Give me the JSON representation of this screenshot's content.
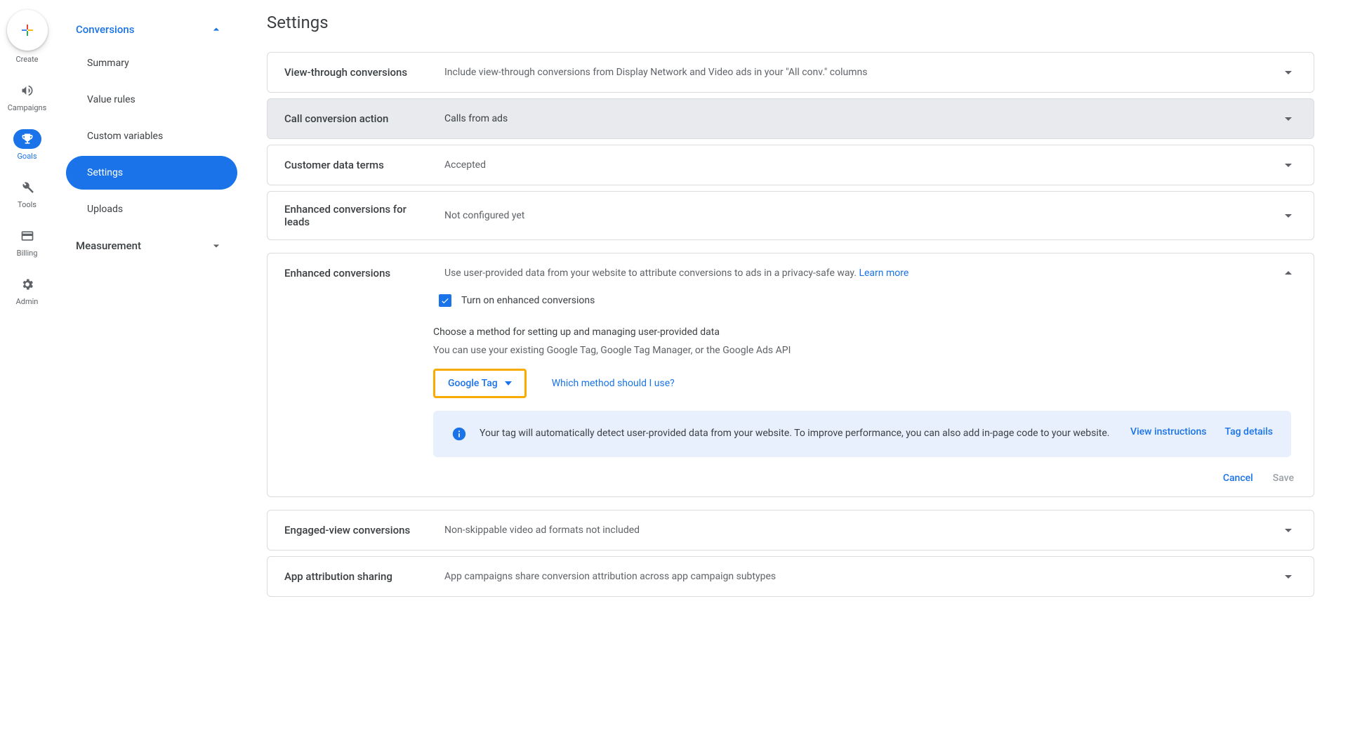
{
  "rail": {
    "create_label": "Create",
    "items": [
      {
        "label": "Campaigns"
      },
      {
        "label": "Goals"
      },
      {
        "label": "Tools"
      },
      {
        "label": "Billing"
      },
      {
        "label": "Admin"
      }
    ]
  },
  "sidebar": {
    "group_conversions": "Conversions",
    "conversions_items": [
      {
        "label": "Summary"
      },
      {
        "label": "Value rules"
      },
      {
        "label": "Custom variables"
      },
      {
        "label": "Settings"
      },
      {
        "label": "Uploads"
      }
    ],
    "group_measurement": "Measurement"
  },
  "page_title": "Settings",
  "cards": {
    "view_through": {
      "title": "View-through conversions",
      "summary": "Include view-through conversions from Display Network and Video ads in your \"All conv.\" columns"
    },
    "call_action": {
      "title": "Call conversion action",
      "summary": "Calls from ads"
    },
    "customer_terms": {
      "title": "Customer data terms",
      "summary": "Accepted"
    },
    "enhanced_leads": {
      "title": "Enhanced conversions for leads",
      "summary": "Not configured yet"
    },
    "enhanced": {
      "title": "Enhanced conversions",
      "summary_prefix": "Use user-provided data from your website to attribute conversions to ads in a privacy-safe way. ",
      "learn_more": "Learn more",
      "checkbox_label": "Turn on enhanced conversions",
      "choose_method": "Choose a method for setting up and managing user-provided data",
      "existing_tag": "You can use your existing Google Tag, Google Tag Manager, or the Google Ads API",
      "dropdown_value": "Google Tag",
      "which_method_link": "Which method should I use?",
      "info_text": "Your tag will automatically detect user-provided data from your website. To improve performance, you can also add in-page code to your website.",
      "view_instructions": "View instructions",
      "tag_details": "Tag details",
      "cancel": "Cancel",
      "save": "Save"
    },
    "engaged_view": {
      "title": "Engaged-view conversions",
      "summary": "Non-skippable video ad formats not included"
    },
    "app_attr": {
      "title": "App attribution sharing",
      "summary": "App campaigns share conversion attribution across app campaign subtypes"
    }
  }
}
